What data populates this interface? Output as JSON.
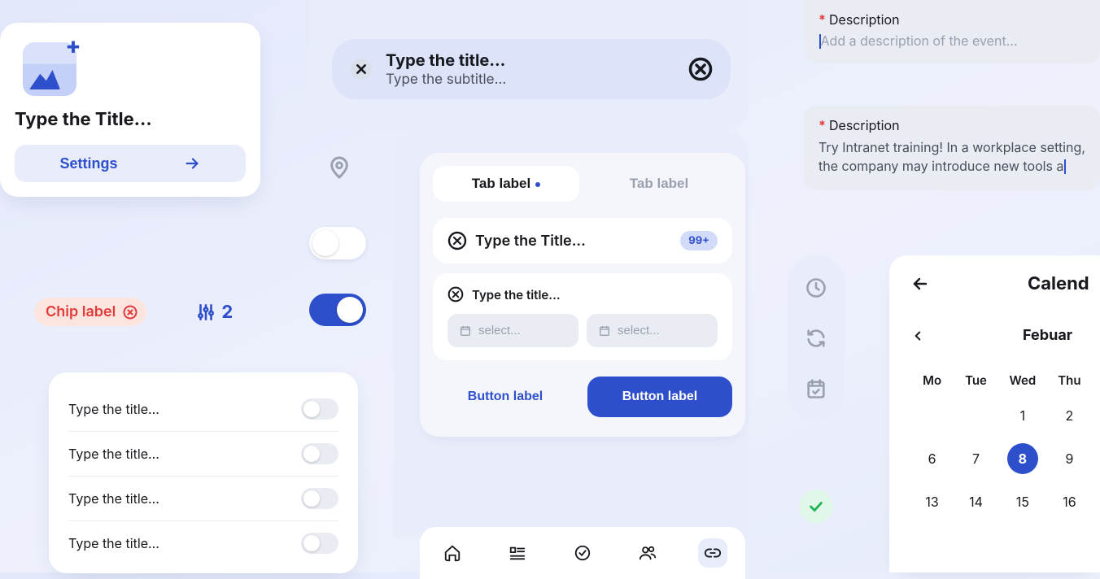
{
  "card": {
    "title": "Type the Title...",
    "settings_label": "Settings"
  },
  "chip": {
    "label": "Chip label"
  },
  "filter": {
    "count": "2"
  },
  "toggle_list": {
    "items": [
      {
        "title": "Type the title..."
      },
      {
        "title": "Type the title..."
      },
      {
        "title": "Type the title..."
      },
      {
        "title": "Type the title..."
      }
    ]
  },
  "header": {
    "title_placeholder": "Type the title...",
    "subtitle_placeholder": "Type the subtitle..."
  },
  "tabs": {
    "active": "Tab label",
    "inactive": "Tab label"
  },
  "mini1": {
    "title": "Type the Title...",
    "badge": "99+"
  },
  "mini2": {
    "title": "Type the title...",
    "select1_ph": "select...",
    "select2_ph": "select..."
  },
  "buttons": {
    "ghost": "Button label",
    "primary": "Button label"
  },
  "desc": {
    "label": "Description",
    "placeholder": "Add a description of the event...",
    "body": "Try Intranet training! In a workplace setting, the company may introduce new tools a"
  },
  "calendar": {
    "title": "Calend",
    "month": "Febuar",
    "dow": [
      "Mo",
      "Tue",
      "Wed",
      "Thu"
    ],
    "rows": [
      [
        "",
        "",
        "1",
        "2"
      ],
      [
        "6",
        "7",
        "8",
        "9"
      ],
      [
        "13",
        "14",
        "15",
        "16"
      ]
    ],
    "selected": "8"
  },
  "colors": {
    "blue": "#2e4fcc",
    "red": "#e33a3a",
    "green": "#20b454"
  }
}
